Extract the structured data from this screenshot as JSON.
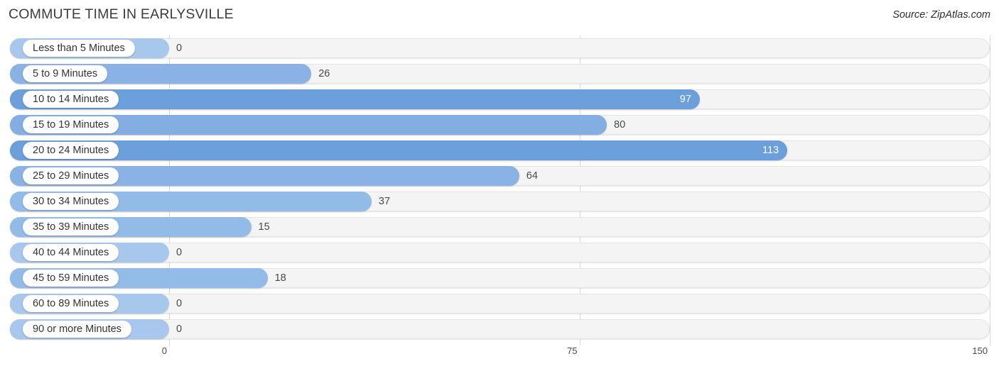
{
  "header": {
    "title": "COMMUTE TIME IN EARLYSVILLE",
    "source": "Source: ZipAtlas.com"
  },
  "colors": {
    "bar_light": "#a7c7ec",
    "bar_mid": "#8ab2e4",
    "bar_strong": "#6a9fdc",
    "track": "#f4f4f4",
    "track_border": "#e3e3e3",
    "gridline": "#d8d8d8",
    "label_text": "#333333",
    "value_text": "#4a4a4a",
    "value_text_inside": "#ffffff",
    "title_text": "#3c3c3c"
  },
  "chart_data": {
    "type": "bar",
    "orientation": "horizontal",
    "title": "COMMUTE TIME IN EARLYSVILLE",
    "xlabel": "",
    "ylabel": "",
    "xlim": [
      0,
      150
    ],
    "xticks": [
      "0",
      "75",
      "150"
    ],
    "xtick_values": [
      0,
      75,
      150
    ],
    "grid": true,
    "legend": "none",
    "categories": [
      "Less than 5 Minutes",
      "5 to 9 Minutes",
      "10 to 14 Minutes",
      "15 to 19 Minutes",
      "20 to 24 Minutes",
      "25 to 29 Minutes",
      "30 to 34 Minutes",
      "35 to 39 Minutes",
      "40 to 44 Minutes",
      "45 to 59 Minutes",
      "60 to 89 Minutes",
      "90 or more Minutes"
    ],
    "values": [
      0,
      26,
      97,
      80,
      113,
      64,
      37,
      15,
      0,
      18,
      0,
      0
    ],
    "value_labels": [
      "0",
      "26",
      "97",
      "80",
      "113",
      "64",
      "37",
      "15",
      "0",
      "18",
      "0",
      "0"
    ]
  },
  "rows": [
    {
      "label": "Less than 5 Minutes",
      "value": 0,
      "value_label": "0",
      "inside": false,
      "color": "#a7c7ec"
    },
    {
      "label": "5 to 9 Minutes",
      "value": 26,
      "value_label": "26",
      "inside": false,
      "color": "#8ab2e4"
    },
    {
      "label": "10 to 14 Minutes",
      "value": 97,
      "value_label": "97",
      "inside": true,
      "color": "#6a9fdc"
    },
    {
      "label": "15 to 19 Minutes",
      "value": 80,
      "value_label": "80",
      "inside": false,
      "color": "#84ade2"
    },
    {
      "label": "20 to 24 Minutes",
      "value": 113,
      "value_label": "113",
      "inside": true,
      "color": "#6a9fdc"
    },
    {
      "label": "25 to 29 Minutes",
      "value": 64,
      "value_label": "64",
      "inside": false,
      "color": "#8ab2e4"
    },
    {
      "label": "30 to 34 Minutes",
      "value": 37,
      "value_label": "37",
      "inside": false,
      "color": "#93bbe8"
    },
    {
      "label": "35 to 39 Minutes",
      "value": 15,
      "value_label": "15",
      "inside": false,
      "color": "#93bbe8"
    },
    {
      "label": "40 to 44 Minutes",
      "value": 0,
      "value_label": "0",
      "inside": false,
      "color": "#a7c7ec"
    },
    {
      "label": "45 to 59 Minutes",
      "value": 18,
      "value_label": "18",
      "inside": false,
      "color": "#93bbe8"
    },
    {
      "label": "60 to 89 Minutes",
      "value": 0,
      "value_label": "0",
      "inside": false,
      "color": "#a7c7ec"
    },
    {
      "label": "90 or more Minutes",
      "value": 0,
      "value_label": "0",
      "inside": false,
      "color": "#a7c7ec"
    }
  ],
  "axis": {
    "ticks": [
      {
        "label": "0",
        "value": 0
      },
      {
        "label": "75",
        "value": 75
      },
      {
        "label": "150",
        "value": 150
      }
    ]
  }
}
